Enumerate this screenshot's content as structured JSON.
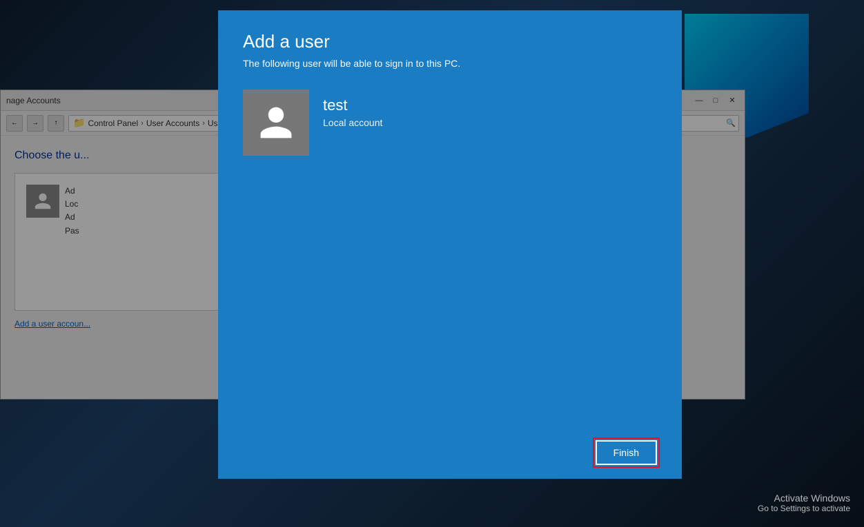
{
  "desktop": {
    "activate_line1": "Activate Windows",
    "activate_line2": "Go to Settings to activate"
  },
  "control_panel": {
    "title": "nage Accounts",
    "breadcrumb": {
      "items": [
        "Control Panel",
        "User Accounts",
        "User..."
      ]
    },
    "search_placeholder": "",
    "heading": "Choose the u...",
    "user_item": {
      "name_prefix": "Ad",
      "detail1": "Loc",
      "detail2": "Ad",
      "detail3": "Pas"
    },
    "add_link": "Add a user accoun..."
  },
  "dialog": {
    "title": "Add a user",
    "subtitle": "The following user will be able to sign in to this PC.",
    "username": "test",
    "account_type": "Local account",
    "finish_button": "Finish"
  }
}
